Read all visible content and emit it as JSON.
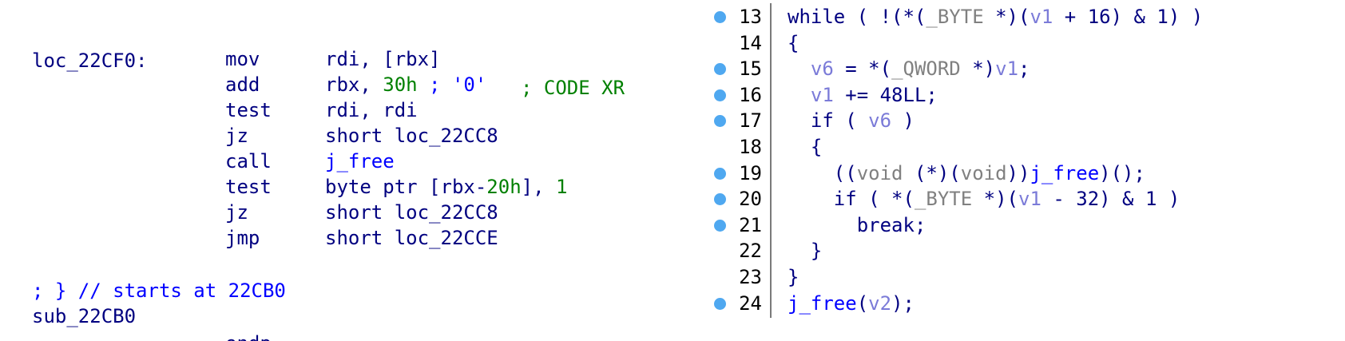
{
  "disassembly": {
    "label": "loc_22CF0:",
    "xref_comment": "; CODE XR",
    "instructions": [
      {
        "mnemonic": "mov",
        "operand_a": "rdi, [rbx]",
        "operand_b": "",
        "operand_c": ""
      },
      {
        "mnemonic": "add",
        "operand_a": "rbx, ",
        "operand_b": "30h",
        "operand_c": " ; '0'"
      },
      {
        "mnemonic": "test",
        "operand_a": "rdi, rdi",
        "operand_b": "",
        "operand_c": ""
      },
      {
        "mnemonic": "jz",
        "operand_a": "short loc_22CC8",
        "operand_b": "",
        "operand_c": ""
      },
      {
        "mnemonic": "call",
        "operand_a": "",
        "operand_b": "j_free",
        "operand_c": ""
      },
      {
        "mnemonic": "test",
        "operand_a": "byte ptr [rbx-",
        "operand_b": "20h",
        "operand_c": "], ",
        "operand_d": "1"
      },
      {
        "mnemonic": "jz",
        "operand_a": "short loc_22CC8",
        "operand_b": "",
        "operand_c": ""
      },
      {
        "mnemonic": "jmp",
        "operand_a": "short loc_22CCE",
        "operand_b": "",
        "operand_c": ""
      }
    ],
    "func_end_comment": "; } // starts at 22CB0",
    "endp_name": "sub_22CB0",
    "endp_keyword": "endp"
  },
  "pseudocode": {
    "lines": [
      {
        "num": "13",
        "breakpoint": true,
        "parts": [
          [
            "kw",
            "while ( !(*("
          ],
          [
            "typ",
            "_BYTE"
          ],
          [
            "kw",
            " *)("
          ],
          [
            "var",
            "v1"
          ],
          [
            "kw",
            " + 16) & 1) )"
          ]
        ]
      },
      {
        "num": "14",
        "breakpoint": false,
        "parts": [
          [
            "kw",
            "{"
          ]
        ]
      },
      {
        "num": "15",
        "breakpoint": true,
        "parts": [
          [
            "kw",
            "  "
          ],
          [
            "var",
            "v6"
          ],
          [
            "kw",
            " = *("
          ],
          [
            "typ",
            "_QWORD"
          ],
          [
            "kw",
            " *)"
          ],
          [
            "var",
            "v1"
          ],
          [
            "kw",
            ";"
          ]
        ]
      },
      {
        "num": "16",
        "breakpoint": true,
        "parts": [
          [
            "kw",
            "  "
          ],
          [
            "var",
            "v1"
          ],
          [
            "kw",
            " += 48LL;"
          ]
        ]
      },
      {
        "num": "17",
        "breakpoint": true,
        "parts": [
          [
            "kw",
            "  if ( "
          ],
          [
            "var",
            "v6"
          ],
          [
            "kw",
            " )"
          ]
        ]
      },
      {
        "num": "18",
        "breakpoint": false,
        "parts": [
          [
            "kw",
            "  {"
          ]
        ]
      },
      {
        "num": "19",
        "breakpoint": true,
        "parts": [
          [
            "kw",
            "    (("
          ],
          [
            "typ",
            "void"
          ],
          [
            "kw",
            " (*)("
          ],
          [
            "typ",
            "void"
          ],
          [
            "kw",
            "))"
          ],
          [
            "fn",
            "j_free"
          ],
          [
            "kw",
            ")();"
          ]
        ]
      },
      {
        "num": "20",
        "breakpoint": true,
        "parts": [
          [
            "kw",
            "    if ( *("
          ],
          [
            "typ",
            "_BYTE"
          ],
          [
            "kw",
            " *)("
          ],
          [
            "var",
            "v1"
          ],
          [
            "kw",
            " - 32) & 1 )"
          ]
        ]
      },
      {
        "num": "21",
        "breakpoint": true,
        "parts": [
          [
            "kw",
            "      break;"
          ]
        ]
      },
      {
        "num": "22",
        "breakpoint": false,
        "parts": [
          [
            "kw",
            "  }"
          ]
        ]
      },
      {
        "num": "23",
        "breakpoint": false,
        "parts": [
          [
            "kw",
            "}"
          ]
        ]
      },
      {
        "num": "24",
        "breakpoint": true,
        "parts": [
          [
            "fn",
            "j_free"
          ],
          [
            "kw",
            "("
          ],
          [
            "var",
            "v2"
          ],
          [
            "kw",
            ");"
          ]
        ]
      }
    ]
  },
  "colors": {
    "breakpoint": "#4fa8f0",
    "code_default": "#000080",
    "immediate": "#008000",
    "comment": "#0000ff",
    "variable": "#7b7bd8",
    "type": "#808080"
  }
}
